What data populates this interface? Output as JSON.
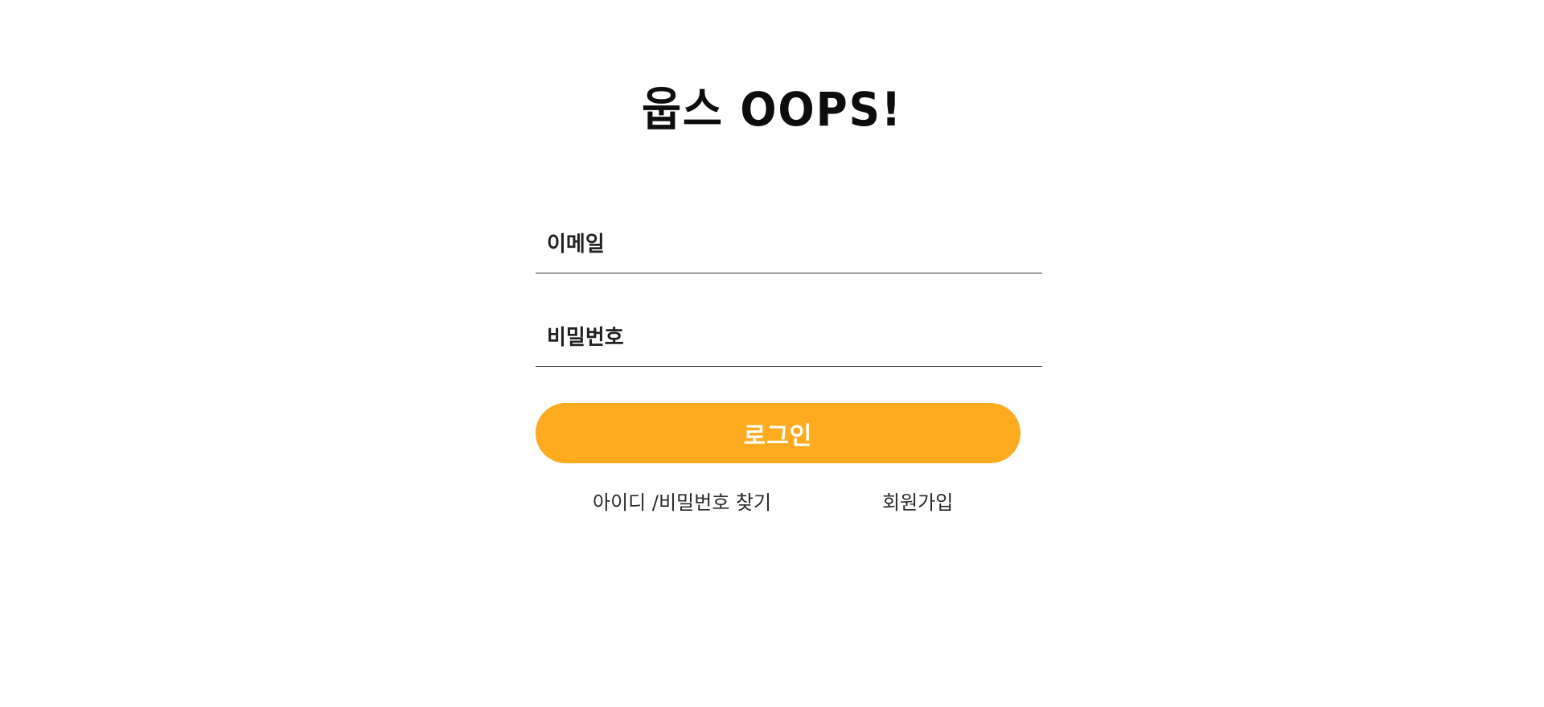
{
  "header": {
    "title": "웁스 OOPS!"
  },
  "form": {
    "email_placeholder": "이메일",
    "password_placeholder": "비밀번호",
    "login_label": "로그인"
  },
  "links": {
    "find_account": "아이디 /비밀번호 찾기",
    "signup": "회원가입"
  },
  "colors": {
    "accent": "#ffab1f",
    "background": "#ffffff",
    "text": "#1a1a1a"
  }
}
